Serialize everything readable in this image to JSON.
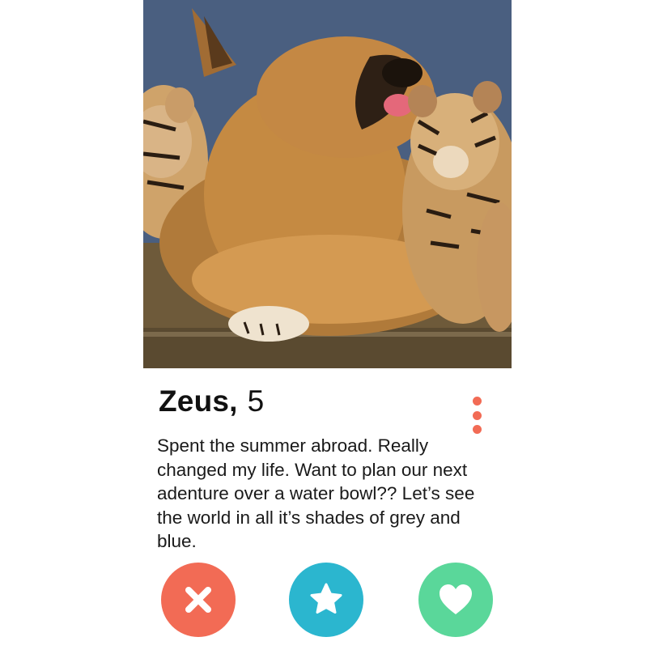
{
  "profile": {
    "name": "Zeus,",
    "age": "5",
    "bio": "Spent the summer abroad. Really changed my life. Want to plan our next adenture over a water bowl?? Let’s see the world in all it’s shades of grey and blue."
  },
  "photo": {
    "icon": "profile-photo",
    "description_visible": false
  },
  "actions": {
    "nope_icon": "close-icon",
    "superlike_icon": "star-icon",
    "like_icon": "heart-icon"
  },
  "colors": {
    "nope": "#f26b55",
    "superlike": "#2bb6cf",
    "like": "#5ad79a",
    "menu_dots": "#f26b55"
  }
}
